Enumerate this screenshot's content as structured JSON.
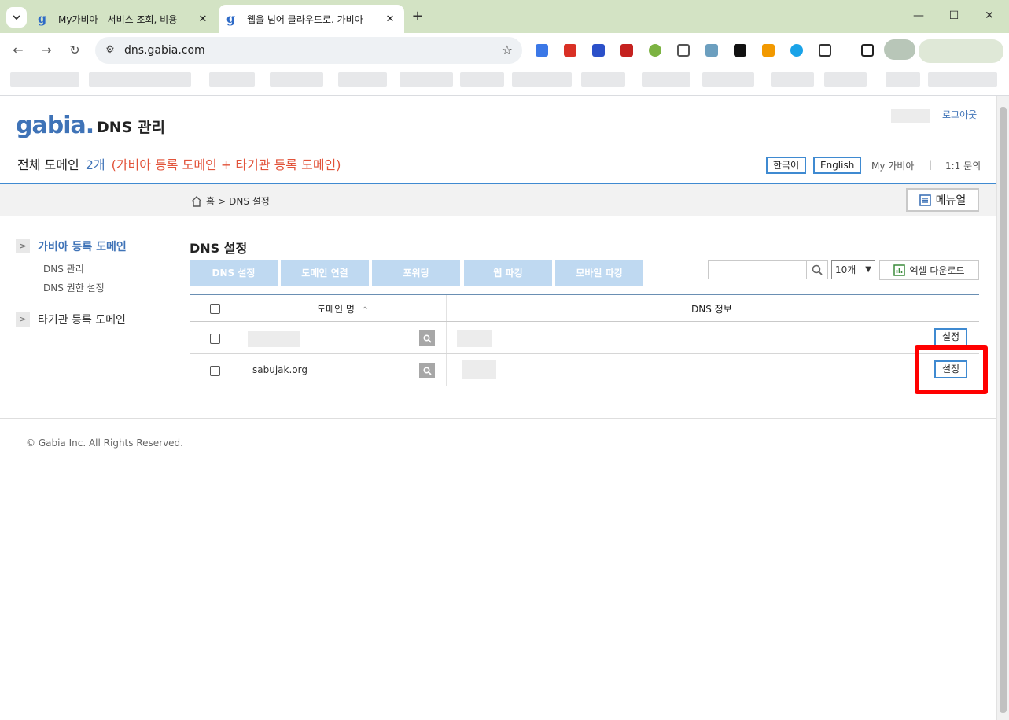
{
  "browser": {
    "tabs": [
      {
        "title": "My가비아 - 서비스 조회, 비용",
        "active": false
      },
      {
        "title": "웹을 넘어 클라우드로. 가비아",
        "active": true
      }
    ],
    "url": "dns.gabia.com"
  },
  "header": {
    "logo": "gabia.",
    "app_title": "DNS 관리",
    "logout": "로그아웃",
    "domain_count_label": "전체 도메인",
    "domain_count_value": "2개",
    "domain_count_note": "(가비아 등록 도메인 + 타기관 등록 도메인)",
    "lang_korean": "한국어",
    "lang_english": "English",
    "my_gabia": "My 가비아",
    "separator": "|",
    "inquiry": "1:1 문의"
  },
  "breadcrumb": {
    "home": "홈",
    "separator": ">",
    "current": "DNS 설정"
  },
  "manual_button": "메뉴얼",
  "sidebar": {
    "groups": [
      {
        "label": "가비아 등록 도메인",
        "items": [
          "DNS 관리",
          "DNS 권한 설정"
        ]
      },
      {
        "label": "타기관 등록 도메인",
        "items": []
      }
    ]
  },
  "main": {
    "title": "DNS 설정",
    "tabs": [
      "DNS 설정",
      "도메인 연결",
      "포워딩",
      "웹 파킹",
      "모바일 파킹"
    ],
    "page_size": "10개",
    "excel_download": "엑셀 다운로드",
    "table": {
      "col_domain": "도메인 명",
      "sort_indicator": "^",
      "col_dns": "DNS 정보",
      "rows": [
        {
          "domain": "",
          "dns": "",
          "action": "설정"
        },
        {
          "domain": "sabujak.org",
          "dns": "",
          "action": "설정"
        }
      ]
    }
  },
  "footer": "© Gabia Inc. All Rights Reserved.",
  "colors": {
    "brand": "#3f73b7",
    "accent_border": "#3f8ad1",
    "note": "#e2533a",
    "tab_disabled": "#bfd9f1",
    "highlight": "#ff0000"
  }
}
